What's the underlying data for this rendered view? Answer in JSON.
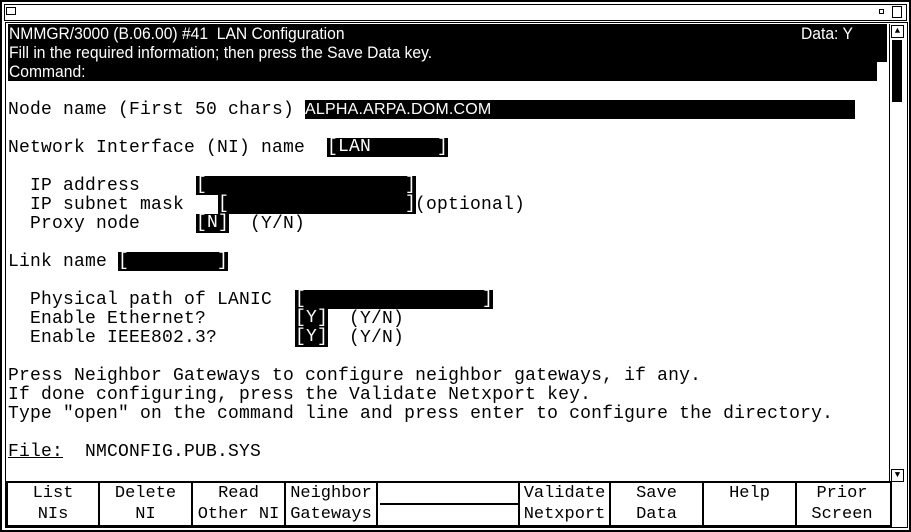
{
  "window": {
    "menu_icon": "window-menu-icon",
    "minimize_icon": "minimize-icon",
    "maximize_icon": "maximize-icon"
  },
  "header": {
    "title": "NMMGR/3000 (B.06.00) #41  LAN Configuration",
    "data_flag": "Data: Y",
    "instruction": "Fill in the required information; then press the Save Data key.",
    "command_label": "Command:",
    "command_value": ""
  },
  "form": {
    "node_name_label": "Node name (First 50 chars)",
    "node_name_value": "ALPHA.ARPA.DOM.COM",
    "ni_name_label": "Network Interface (NI) name",
    "ni_name_value": "[LAN      ]",
    "ip_address_label": "IP address",
    "ip_address_value": "[                  ]",
    "subnet_label": "IP subnet mask",
    "subnet_value": "[                ]",
    "subnet_note": "(optional)",
    "proxy_label": "Proxy node",
    "proxy_value": "[N]",
    "proxy_note": "(Y/N)",
    "link_name_label": "Link name",
    "link_name_value": "[        ]",
    "lanic_label": "Physical path of LANIC",
    "lanic_value": "[                ]",
    "ethernet_label": "Enable Ethernet?",
    "ethernet_value": "[Y]",
    "ethernet_note": "(Y/N)",
    "ieee_label": "Enable IEEE802.3?",
    "ieee_value": "[Y]",
    "ieee_note": "(Y/N)"
  },
  "messages": [
    "Press Neighbor Gateways to configure neighbor gateways, if any.",
    "If done configuring, press the Validate Netxport key.",
    "Type \"open\" on the command line and press enter to configure the directory."
  ],
  "file": {
    "label": "File:",
    "value": "NMCONFIG.PUB.SYS"
  },
  "function_keys": [
    {
      "label": "List\nNIs"
    },
    {
      "label": "Delete\nNI"
    },
    {
      "label": "Read\nOther NI"
    },
    {
      "label": "Neighbor\nGateways"
    },
    {
      "label": ""
    },
    {
      "label": "Validate\nNetxport"
    },
    {
      "label": "Save\nData"
    },
    {
      "label": "Help"
    },
    {
      "label": "Prior\nScreen"
    }
  ],
  "scrollbar": {
    "up_icon": "scroll-up-arrow",
    "down_icon": "scroll-down-arrow"
  }
}
